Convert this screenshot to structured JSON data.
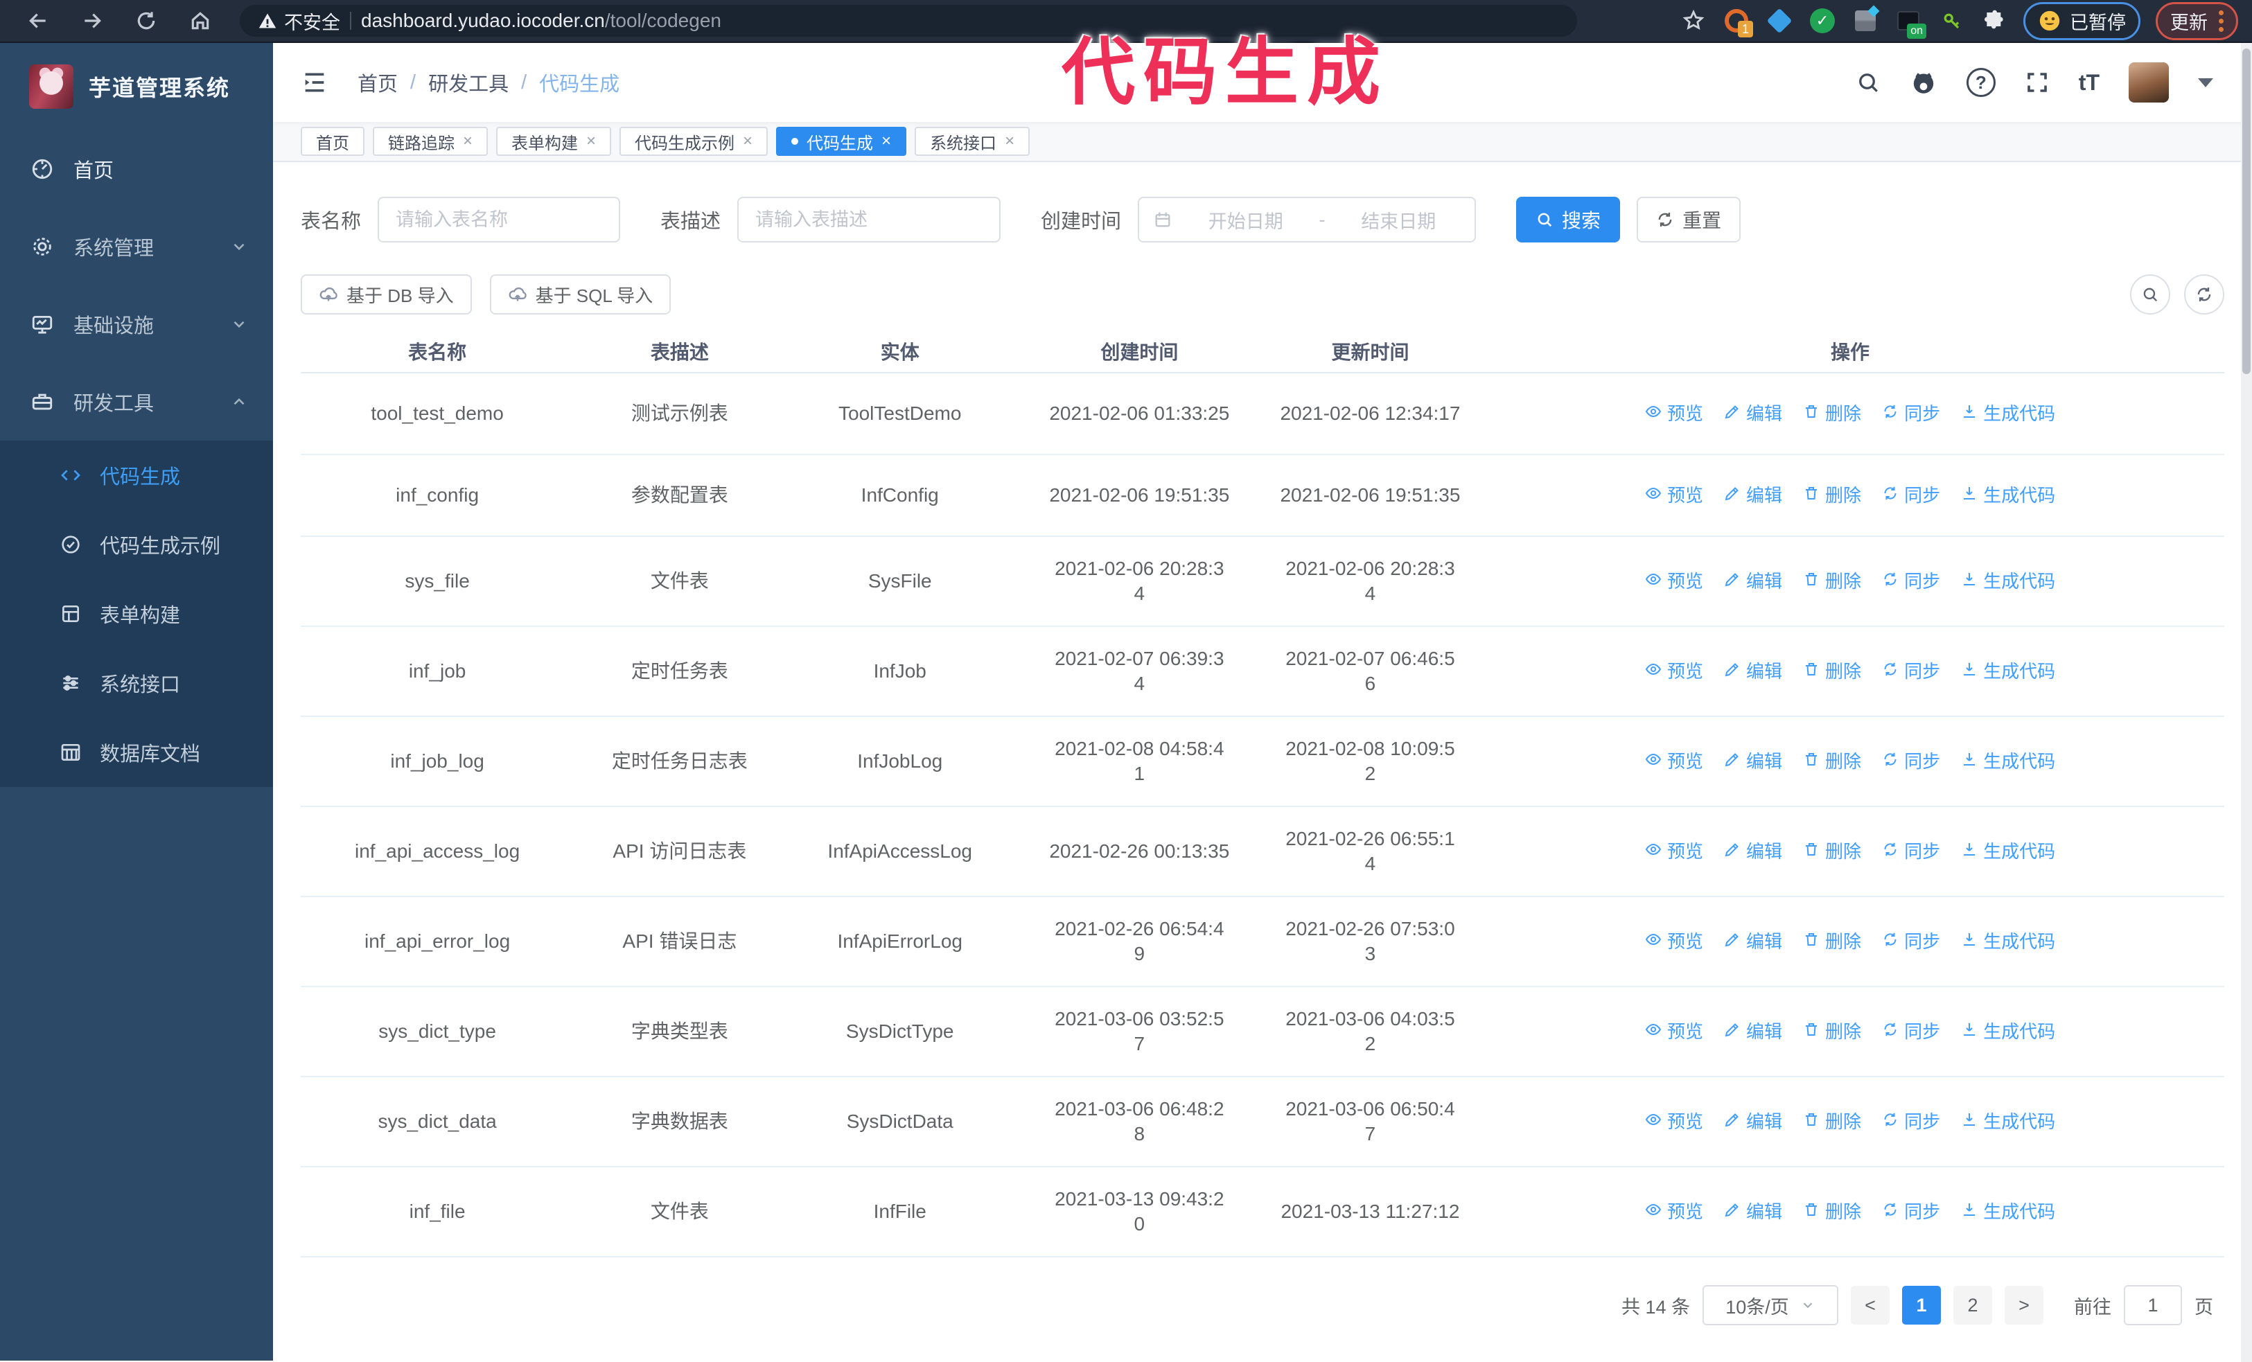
{
  "colors": {
    "primary": "#2d8cf0",
    "link": "#409eff",
    "annotation": "#ee3059",
    "sidebar_bg": "#2c4a67",
    "sidebar_sub_bg": "#203c58"
  },
  "annotation": {
    "title": "代码生成"
  },
  "browser": {
    "security_label": "不安全",
    "url_host": "dashboard.yudao.iocoder.cn",
    "url_path": "/tool/codegen",
    "extension_badge": "1",
    "extension_on_badge": "on",
    "paused_badge": "已暂停",
    "update_button": "更新"
  },
  "sidebar": {
    "app_title": "芋道管理系统",
    "items": [
      {
        "label": "首页"
      },
      {
        "label": "系统管理"
      },
      {
        "label": "基础设施"
      },
      {
        "label": "研发工具"
      }
    ],
    "submenu": [
      {
        "label": "代码生成"
      },
      {
        "label": "代码生成示例"
      },
      {
        "label": "表单构建"
      },
      {
        "label": "系统接口"
      },
      {
        "label": "数据库文档"
      }
    ]
  },
  "header": {
    "breadcrumb": {
      "home": "首页",
      "section": "研发工具",
      "current": "代码生成"
    }
  },
  "tabs": [
    {
      "label": "首页"
    },
    {
      "label": "链路追踪"
    },
    {
      "label": "表单构建"
    },
    {
      "label": "代码生成示例"
    },
    {
      "label": "代码生成"
    },
    {
      "label": "系统接口"
    }
  ],
  "filters": {
    "table_name_label": "表名称",
    "table_name_placeholder": "请输入表名称",
    "table_desc_label": "表描述",
    "table_desc_placeholder": "请输入表描述",
    "create_time_label": "创建时间",
    "date_start_placeholder": "开始日期",
    "date_separator": "-",
    "date_end_placeholder": "结束日期",
    "search_button": "搜索",
    "reset_button": "重置"
  },
  "toolbar": {
    "import_db": "基于 DB 导入",
    "import_sql": "基于 SQL 导入"
  },
  "table": {
    "columns": [
      "表名称",
      "表描述",
      "实体",
      "创建时间",
      "更新时间",
      "操作"
    ],
    "actions": [
      {
        "name": "preview",
        "label": "预览",
        "icon": "eye"
      },
      {
        "name": "edit",
        "label": "编辑",
        "icon": "edit"
      },
      {
        "name": "delete",
        "label": "删除",
        "icon": "trash"
      },
      {
        "name": "sync",
        "label": "同步",
        "icon": "sync"
      },
      {
        "name": "generate-code",
        "label": "生成代码",
        "icon": "download"
      }
    ],
    "rows": [
      {
        "name": "tool_test_demo",
        "desc": "测试示例表",
        "entity": "ToolTestDemo",
        "created": "2021-02-06 01:33:25",
        "updated": "2021-02-06 12:34:17"
      },
      {
        "name": "inf_config",
        "desc": "参数配置表",
        "entity": "InfConfig",
        "created": "2021-02-06 19:51:35",
        "updated": "2021-02-06 19:51:35"
      },
      {
        "name": "sys_file",
        "desc": "文件表",
        "entity": "SysFile",
        "created": "2021-02-06 20:28:3\n4",
        "updated": "2021-02-06 20:28:3\n4"
      },
      {
        "name": "inf_job",
        "desc": "定时任务表",
        "entity": "InfJob",
        "created": "2021-02-07 06:39:3\n4",
        "updated": "2021-02-07 06:46:5\n6"
      },
      {
        "name": "inf_job_log",
        "desc": "定时任务日志表",
        "entity": "InfJobLog",
        "created": "2021-02-08 04:58:4\n1",
        "updated": "2021-02-08 10:09:5\n2"
      },
      {
        "name": "inf_api_access_log",
        "desc": "API 访问日志表",
        "entity": "InfApiAccessLog",
        "created": "2021-02-26 00:13:35",
        "updated": "2021-02-26 06:55:1\n4"
      },
      {
        "name": "inf_api_error_log",
        "desc": "API 错误日志",
        "entity": "InfApiErrorLog",
        "created": "2021-02-26 06:54:4\n9",
        "updated": "2021-02-26 07:53:0\n3"
      },
      {
        "name": "sys_dict_type",
        "desc": "字典类型表",
        "entity": "SysDictType",
        "created": "2021-03-06 03:52:5\n7",
        "updated": "2021-03-06 04:03:5\n2"
      },
      {
        "name": "sys_dict_data",
        "desc": "字典数据表",
        "entity": "SysDictData",
        "created": "2021-03-06 06:48:2\n8",
        "updated": "2021-03-06 06:50:4\n7"
      },
      {
        "name": "inf_file",
        "desc": "文件表",
        "entity": "InfFile",
        "created": "2021-03-13 09:43:2\n0",
        "updated": "2021-03-13 11:27:12"
      }
    ]
  },
  "pagination": {
    "total": "共 14 条",
    "page_size": "10条/页",
    "prev": "<",
    "next": ">",
    "pages": [
      "1",
      "2"
    ],
    "active_page": "1",
    "goto_label": "前往",
    "goto_value": "1",
    "goto_suffix": "页"
  }
}
